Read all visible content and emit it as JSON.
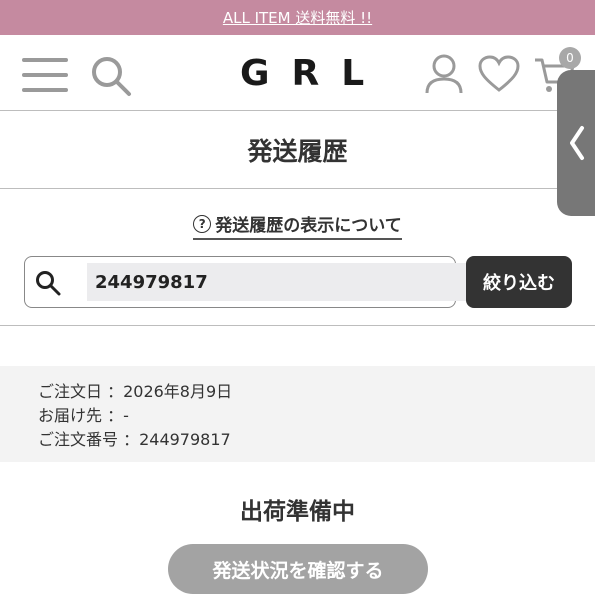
{
  "promo": {
    "text": "ALL ITEM 送料無料 !!"
  },
  "header": {
    "logo": "GRL",
    "cart_count": "0"
  },
  "page": {
    "title": "発送履歴"
  },
  "help": {
    "label": "発送履歴の表示について",
    "icon": "?"
  },
  "search": {
    "value": "244979817",
    "button_label": "絞り込む"
  },
  "order": {
    "date_line": "ご注文日 ：2026年8月9日",
    "address_line": "お届け先 ：-",
    "number_line": "ご注文番号 ：244979817"
  },
  "status": {
    "label": "出荷準備中",
    "track_button": "発送状況を確認する"
  },
  "colors": {
    "promo_bg": "#c58aa0",
    "button_dark": "#333333",
    "button_gray": "#a3a3a3"
  }
}
